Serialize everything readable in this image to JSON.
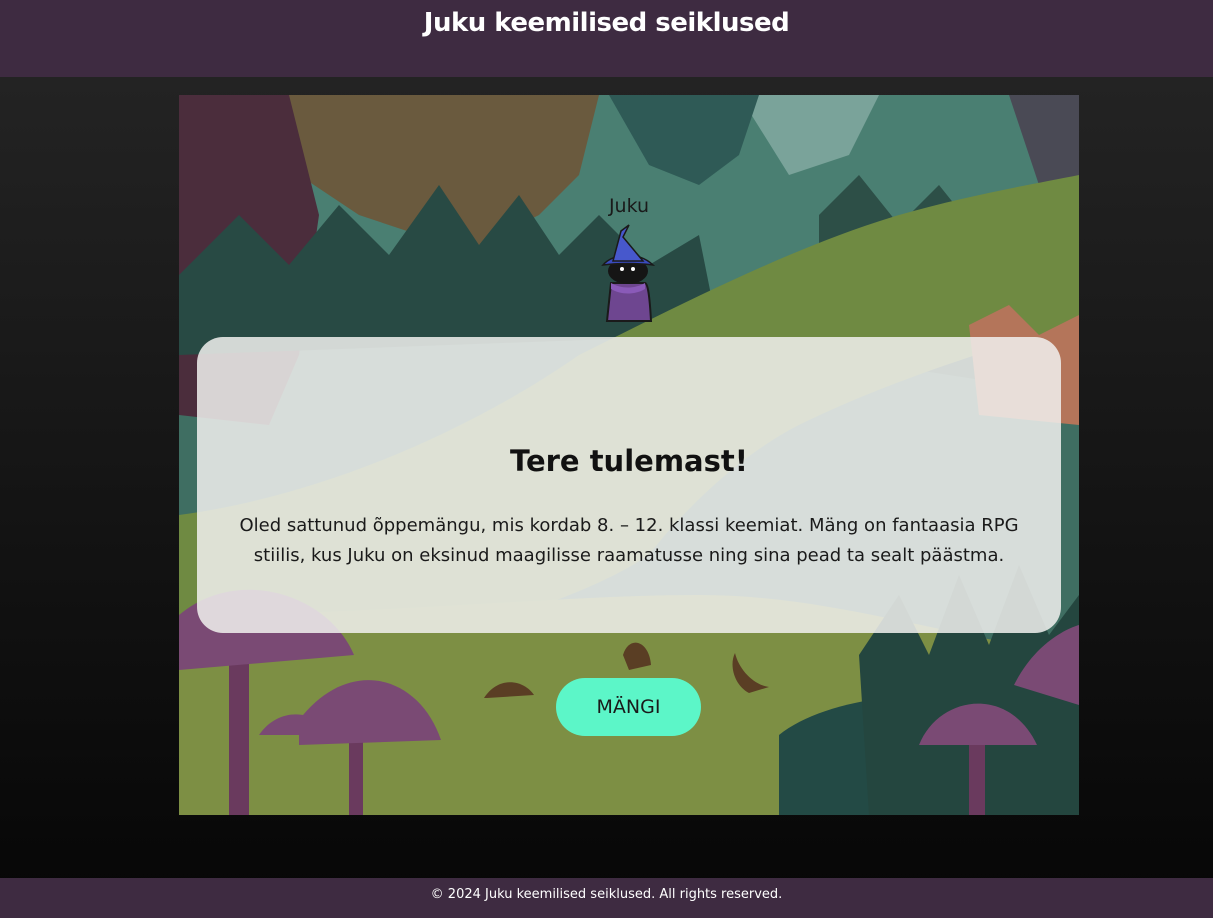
{
  "header": {
    "title": "Juku keemilised seiklused"
  },
  "game": {
    "character": {
      "name": "Juku",
      "icon": "wizard-icon"
    },
    "dialog": {
      "title": "Tere tulemast!",
      "body": "Oled sattunud õppemängu, mis kordab 8. – 12. klassi keemiat. Mäng on fantaasia RPG stiilis, kus Juku on eksinud maagilisse raamatusse ning sina pead ta sealt päästma."
    },
    "play_button": {
      "label": "MÄNGI",
      "color": "#5cf6c8"
    }
  },
  "footer": {
    "text": "© 2024 Juku keemilised seiklused. All rights reserved."
  },
  "colors": {
    "header_bg": "#3e2b41",
    "footer_bg": "#3e2b41"
  }
}
